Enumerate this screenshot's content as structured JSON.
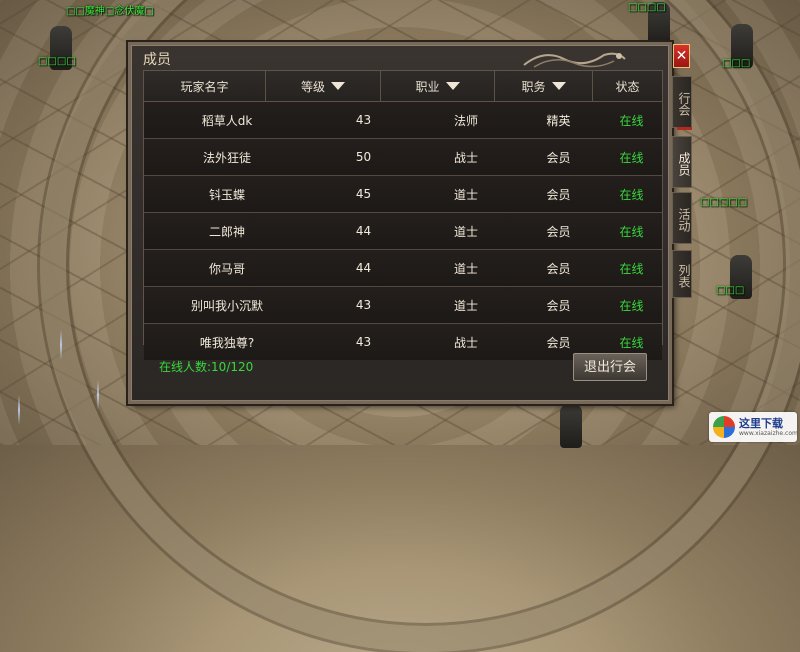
{
  "scene": {
    "npcs": [
      {
        "name": "□□魔神□念伏魔□"
      },
      {
        "name": "□□□□"
      },
      {
        "name": "□□□□"
      },
      {
        "name": "□□□"
      },
      {
        "name": "□□□"
      },
      {
        "name": "□□□□□"
      }
    ]
  },
  "panel": {
    "title": "成员",
    "close_label": "✕",
    "columns": [
      {
        "label": "玩家名字",
        "sortable": false
      },
      {
        "label": "等级",
        "sortable": true
      },
      {
        "label": "职业",
        "sortable": true
      },
      {
        "label": "职务",
        "sortable": true
      },
      {
        "label": "状态",
        "sortable": false
      }
    ],
    "rows": [
      {
        "name": "稻草人dk",
        "level": "43",
        "class": "法师",
        "role": "精英",
        "status": "在线"
      },
      {
        "name": "法外狂徒",
        "level": "50",
        "class": "战士",
        "role": "会员",
        "status": "在线"
      },
      {
        "name": "钭玉蝶",
        "level": "45",
        "class": "道士",
        "role": "会员",
        "status": "在线"
      },
      {
        "name": "二郎神",
        "level": "44",
        "class": "道士",
        "role": "会员",
        "status": "在线"
      },
      {
        "name": "你马哥",
        "level": "44",
        "class": "道士",
        "role": "会员",
        "status": "在线"
      },
      {
        "name": "别叫我小沉默",
        "level": "43",
        "class": "道士",
        "role": "会员",
        "status": "在线"
      },
      {
        "name": "唯我独尊?",
        "level": "43",
        "class": "战士",
        "role": "会员",
        "status": "在线"
      }
    ],
    "online_count": "在线人数:10/120",
    "leave_button": "退出行会"
  },
  "side_tabs": [
    {
      "label": "行会",
      "active": false
    },
    {
      "label": "成员",
      "active": true
    },
    {
      "label": "活动",
      "active": false
    },
    {
      "label": "列表",
      "active": false
    }
  ],
  "watermark": {
    "text": "这里下载",
    "url": "www.xiazaizhe.com"
  },
  "colors": {
    "online": "#37d83b",
    "text": "#f1e9da",
    "close": "#c4241b"
  }
}
